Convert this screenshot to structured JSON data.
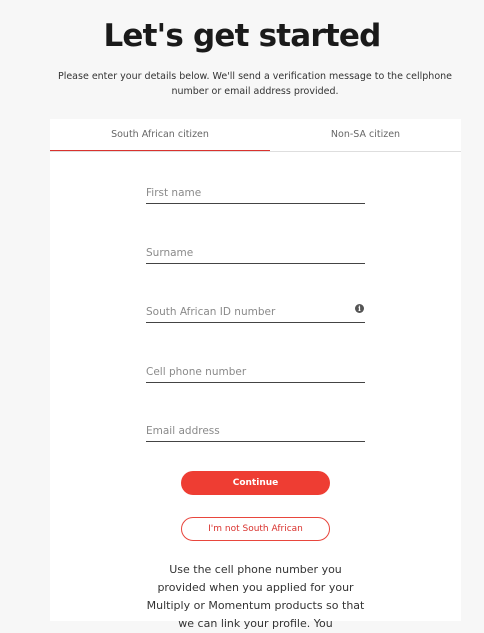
{
  "header": {
    "title": "Let's get started",
    "intro": "Please enter your details below. We'll send a verification message to the cellphone number or email address provided."
  },
  "tabs": [
    {
      "label": "South African citizen",
      "active": true
    },
    {
      "label": "Non-SA citizen",
      "active": false
    }
  ],
  "form": {
    "first_name_placeholder": "First name",
    "surname_placeholder": "Surname",
    "id_number_placeholder": "South African ID number",
    "cell_placeholder": "Cell phone number",
    "email_placeholder": "Email address",
    "info_icon_glyph": "i"
  },
  "buttons": {
    "continue_label": "Continue",
    "not_sa_label": "I'm not South African"
  },
  "help_text": "Use the cell phone number you provided when you applied for your Multiply or Momentum products so that we can link your profile. You",
  "colors": {
    "accent": "#ee3d33",
    "tab_underline": "#d9322e",
    "background": "#f7f7f7"
  }
}
